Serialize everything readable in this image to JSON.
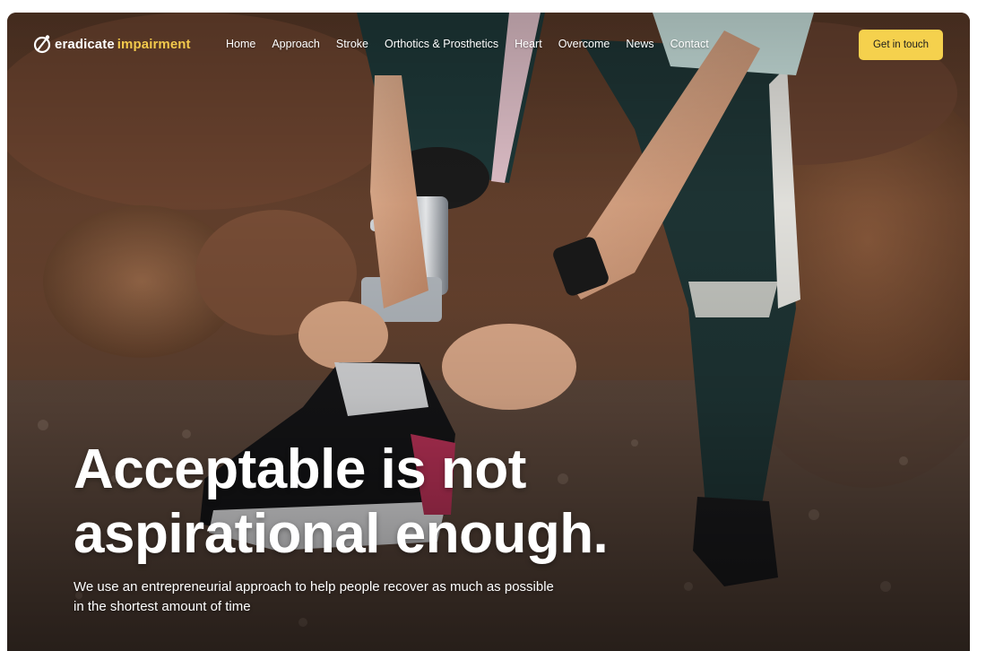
{
  "brand": {
    "name_part1": "eradicate",
    "name_part2": "impairment",
    "accent_color": "#f2c94c"
  },
  "nav": {
    "items": [
      {
        "label": "Home"
      },
      {
        "label": "Approach"
      },
      {
        "label": "Stroke"
      },
      {
        "label": "Orthotics & Prosthetics"
      },
      {
        "label": "Heart"
      },
      {
        "label": "Overcome"
      },
      {
        "label": "News"
      },
      {
        "label": "Contact"
      }
    ],
    "cta_label": "Get in touch",
    "cta_color": "#f5d14d"
  },
  "hero": {
    "title_line1": "Acceptable is not",
    "title_line2": "aspirational enough.",
    "subtitle": "We use an entrepreneurial approach to help people recover as much as possible in the shortest amount of time",
    "image_icon": "prosthetic-leg-runner-photo"
  }
}
